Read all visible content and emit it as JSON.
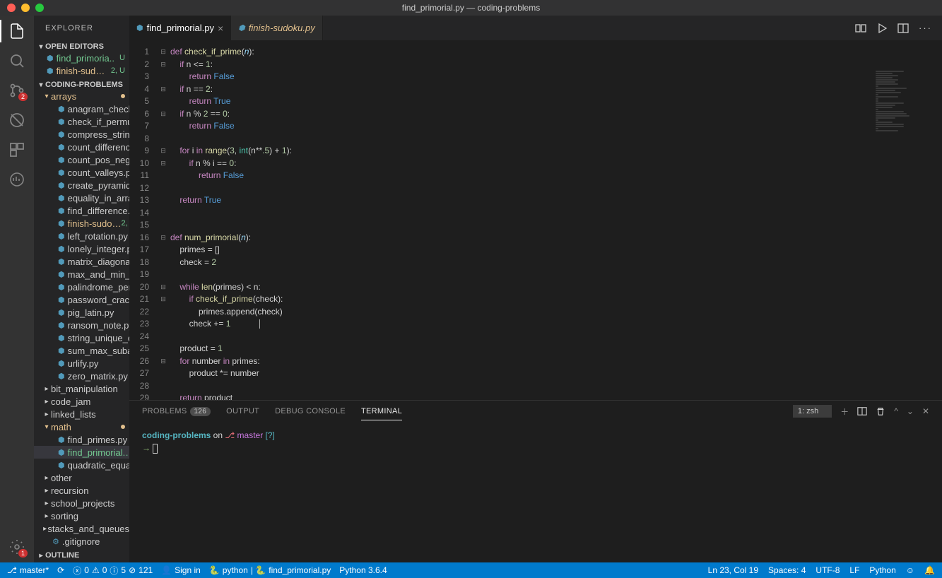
{
  "window_title": "find_primorial.py — coding-problems",
  "sidebar": {
    "header": "EXPLORER",
    "open_editors_label": "OPEN EDITORS",
    "open_editors": [
      {
        "name": "find_primoria..",
        "suffix": "U",
        "class": "unt"
      },
      {
        "name": "finish-sud…",
        "suffix": "2, U",
        "class": "mod"
      }
    ],
    "project_label": "CODING-PROBLEMS",
    "tree": [
      {
        "type": "folder",
        "name": "arrays",
        "open": true,
        "mod": true,
        "children": [
          {
            "name": "anagram_check.py"
          },
          {
            "name": "check_if_permutat…"
          },
          {
            "name": "compress_string.py"
          },
          {
            "name": "count_differences…"
          },
          {
            "name": "count_pos_neg_ze…"
          },
          {
            "name": "count_valleys.py"
          },
          {
            "name": "create_pyramid.py"
          },
          {
            "name": "equality_in_array.py"
          },
          {
            "name": "find_difference.py"
          },
          {
            "name": "finish-sudo…",
            "suffix": "2, U",
            "class": "mod"
          },
          {
            "name": "left_rotation.py"
          },
          {
            "name": "lonely_integer.py"
          },
          {
            "name": "matrix_diagonal_di…"
          },
          {
            "name": "max_and_min_sum…"
          },
          {
            "name": "palindrome_permu…"
          },
          {
            "name": "password_cracker…"
          },
          {
            "name": "pig_latin.py"
          },
          {
            "name": "ransom_note.py"
          },
          {
            "name": "string_unique_cha…"
          },
          {
            "name": "sum_max_subarra…"
          },
          {
            "name": "urlify.py"
          },
          {
            "name": "zero_matrix.py"
          }
        ]
      },
      {
        "type": "folder",
        "name": "bit_manipulation"
      },
      {
        "type": "folder",
        "name": "code_jam"
      },
      {
        "type": "folder",
        "name": "linked_lists"
      },
      {
        "type": "folder",
        "name": "math",
        "open": true,
        "mod": true,
        "children": [
          {
            "name": "find_primes.py"
          },
          {
            "name": "find_primorial.…",
            "suffix": "U",
            "class": "unt",
            "sel": true
          },
          {
            "name": "quadratic_equatio…"
          }
        ]
      },
      {
        "type": "folder",
        "name": "other"
      },
      {
        "type": "folder",
        "name": "recursion"
      },
      {
        "type": "folder",
        "name": "school_projects"
      },
      {
        "type": "folder",
        "name": "sorting"
      },
      {
        "type": "folder",
        "name": "stacks_and_queues"
      },
      {
        "type": "file",
        "name": ".gitignore",
        "plain": true
      }
    ],
    "outline_label": "OUTLINE"
  },
  "tabs": [
    {
      "name": "find_primorial.py",
      "active": true
    },
    {
      "name": "finish-sudoku.py",
      "mod": true
    }
  ],
  "code_lines": 30,
  "panel": {
    "tabs": [
      "PROBLEMS",
      "OUTPUT",
      "DEBUG CONSOLE",
      "TERMINAL"
    ],
    "active": "TERMINAL",
    "problems_count": "126",
    "terminal_sel": "1: zsh",
    "term_line1_a": "coding-problems",
    "term_line1_b": " on ",
    "term_branch_icon": "⎇",
    "term_branch": " master",
    "term_branch_suffix": " [?]",
    "term_arrow": "→ "
  },
  "status": {
    "branch": "master*",
    "sync": "⟳",
    "err": "0",
    "warn": "0",
    "info": "5",
    "problems": "121",
    "signin": "Sign in",
    "python_env": "python",
    "file": "find_primorial.py",
    "py_version": "Python 3.6.4",
    "lncol": "Ln 23, Col 19",
    "spaces": "Spaces: 4",
    "encoding": "UTF-8",
    "eol": "LF",
    "lang": "Python"
  },
  "activity_badge_scm": "2",
  "activity_badge_settings": "1"
}
